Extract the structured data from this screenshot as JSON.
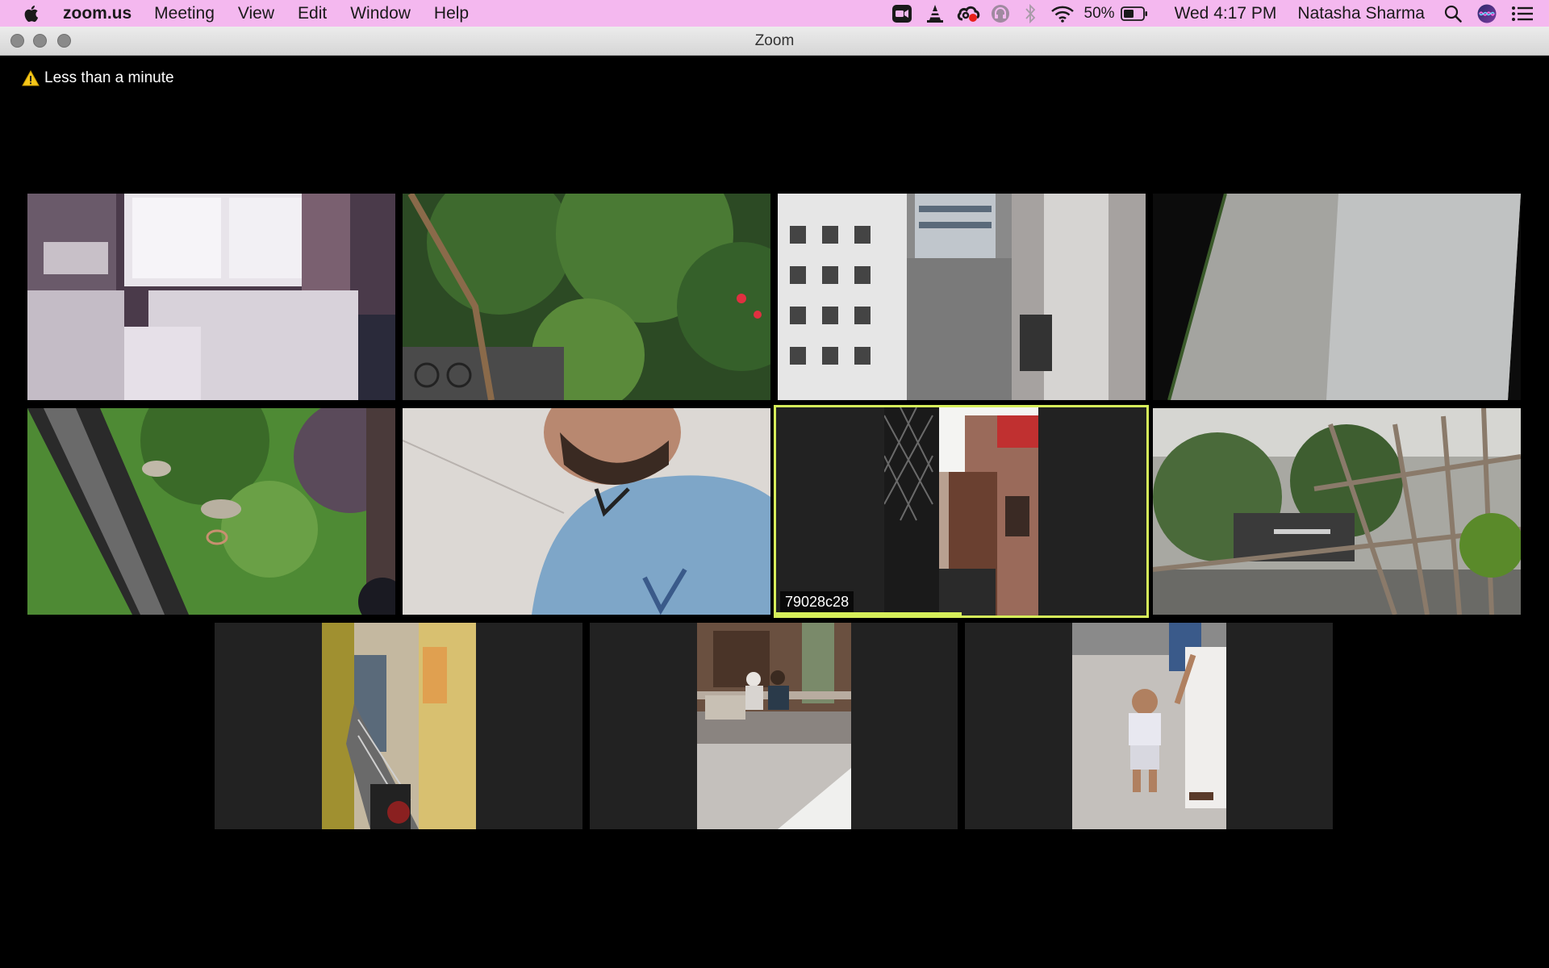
{
  "menubar": {
    "app_name": "zoom.us",
    "menus": [
      "Meeting",
      "View",
      "Edit",
      "Window",
      "Help"
    ],
    "battery_percent": "50%",
    "clock": "Wed 4:17 PM",
    "user": "Natasha Sharma",
    "status_icons": [
      "zoom-camera-icon",
      "vlc-cone-icon",
      "creative-cloud-icon",
      "headset-icon",
      "bluetooth-icon",
      "wifi-icon",
      "battery-icon",
      "spotlight-search-icon",
      "siri-icon",
      "notification-center-icon"
    ]
  },
  "window": {
    "title": "Zoom"
  },
  "meeting": {
    "timer_note": "Less than a minute",
    "warning_icon": "warning-icon",
    "active_speaker_label": "79028c28",
    "accent_color": "#d6ef5a",
    "tiles": [
      {
        "scene": "office room with window and cabinets"
      },
      {
        "scene": "trees and bicycles outdoors"
      },
      {
        "scene": "city street from balcony"
      },
      {
        "scene": "white wall close-up"
      },
      {
        "scene": "garden seen through window"
      },
      {
        "scene": "person in blue shirt close-up"
      },
      {
        "scene": "alley with lattice window",
        "active": true
      },
      {
        "scene": "street behind scaffolding"
      },
      {
        "scene": "narrow lane with stairs"
      },
      {
        "scene": "people sitting at doorway"
      },
      {
        "scene": "child standing in street"
      }
    ]
  }
}
